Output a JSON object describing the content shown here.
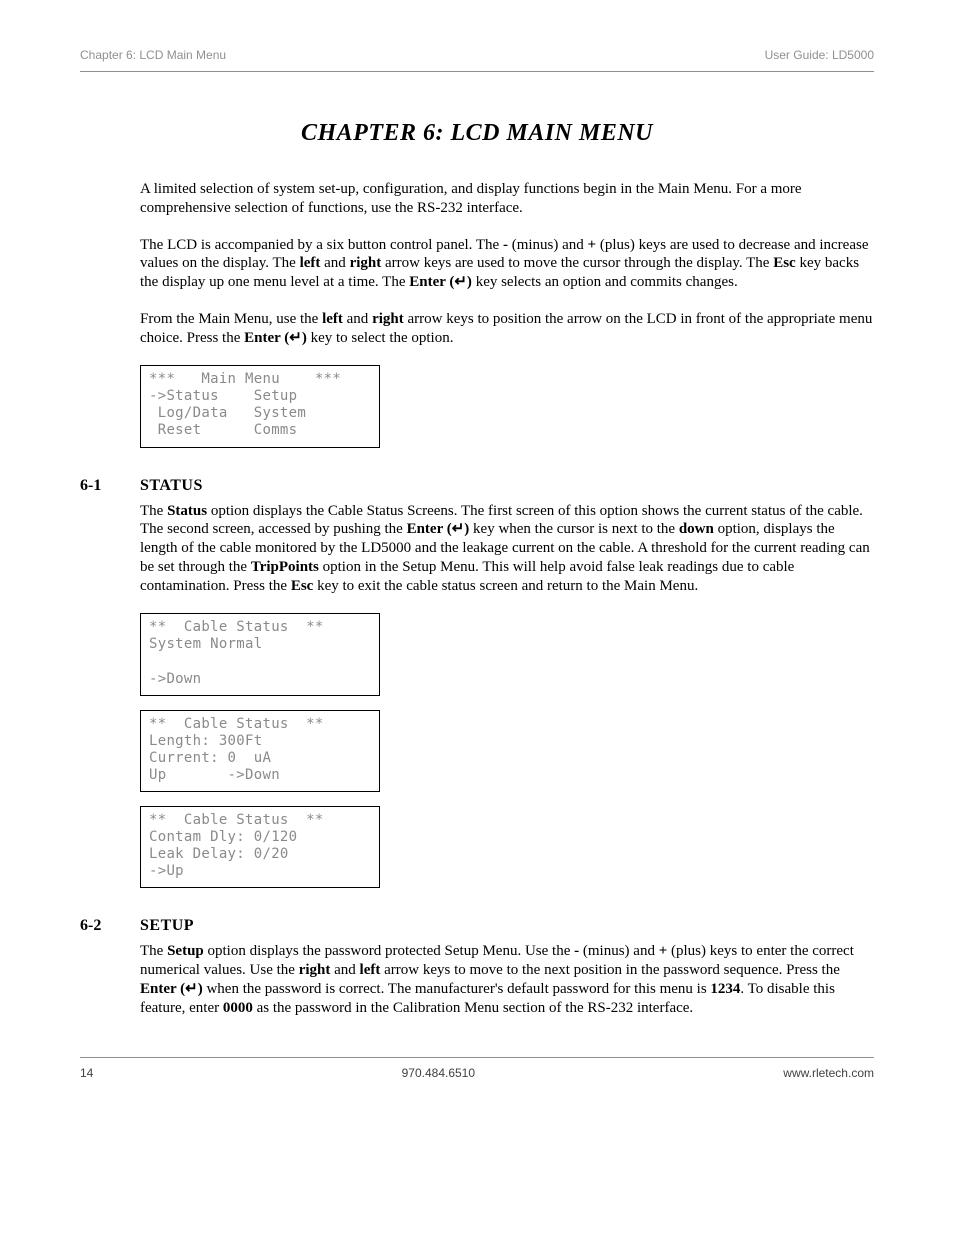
{
  "header": {
    "left": "Chapter 6: LCD Main Menu",
    "right": "User Guide: LD5000"
  },
  "chapter_title": "CHAPTER 6:  LCD MAIN MENU",
  "intro": {
    "p1": "A limited selection of system set-up, configuration, and display functions begin in the Main Menu.  For a more comprehensive selection of functions, use the RS-232 interface.",
    "p2_a": "The LCD is accompanied by a six button control panel.  The ",
    "p2_minus": "-",
    "p2_b": " (minus) and ",
    "p2_plus": "+",
    "p2_c": " (plus) keys are used to decrease and increase values on the display.  The ",
    "p2_left": "left",
    "p2_d": " and ",
    "p2_right": "right",
    "p2_e": " arrow keys are used to move the cursor through the display.  The ",
    "p2_esc": "Esc",
    "p2_f": " key backs the display up one menu level at a time.  The ",
    "p2_enter": "Enter (↵)",
    "p2_g": " key selects an option and commits changes.",
    "p3_a": "From the Main Menu, use the ",
    "p3_left": "left",
    "p3_b": " and ",
    "p3_right": "right",
    "p3_c": " arrow keys to position the arrow on the LCD in front of the appropriate menu choice.  Press the ",
    "p3_enter": "Enter (↵)",
    "p3_d": " key to select the option."
  },
  "lcd_main": "***   Main Menu    ***\n->Status    Setup\n Log/Data   System\n Reset      Comms",
  "sec61": {
    "num": "6-1",
    "title": "STATUS",
    "p_a": "The ",
    "p_status": "Status",
    "p_b": " option displays the Cable Status Screens.  The first screen of this option shows the current status of the cable.  The second screen, accessed by pushing the ",
    "p_enter": "Enter (↵)",
    "p_c": " key when the cursor is next to the ",
    "p_down": "down",
    "p_d": " option, displays the length of the cable monitored by the LD5000 and the leakage current on the cable.  A threshold for the current reading can be set through the ",
    "p_trip": "TripPoints",
    "p_e": " option in the Setup Menu.  This will help avoid false leak readings due to cable contamination.  Press the ",
    "p_esc": "Esc",
    "p_f": " key to exit the cable status screen and return to the Main Menu."
  },
  "lcd_status1": "**  Cable Status  **\nSystem Normal\n\n->Down",
  "lcd_status2": "**  Cable Status  **\nLength: 300Ft\nCurrent: 0  uA\nUp       ->Down",
  "lcd_status3": "**  Cable Status  **\nContam Dly: 0/120\nLeak Delay: 0/20\n->Up",
  "sec62": {
    "num": "6-2",
    "title": "SETUP",
    "p_a": "The ",
    "p_setup": "Setup",
    "p_b": " option displays the password protected Setup Menu. Use the ",
    "p_minus": "-",
    "p_c": " (minus) and ",
    "p_plus": "+",
    "p_d": " (plus) keys to enter the correct numerical values.  Use the ",
    "p_right": "right",
    "p_e": " and ",
    "p_left": "left",
    "p_f": " arrow keys to move to the next position in the password sequence.  Press the ",
    "p_enter": "Enter (↵)",
    "p_g": " when the password is correct.  The manufacturer's default password for this menu is ",
    "p_pw": "1234",
    "p_h": ".  To disable this feature, enter ",
    "p_zero": "0000",
    "p_i": " as the password in the Calibration Menu section of the RS-232 interface."
  },
  "footer": {
    "left": "14",
    "center": "970.484.6510",
    "right": "www.rletech.com"
  }
}
